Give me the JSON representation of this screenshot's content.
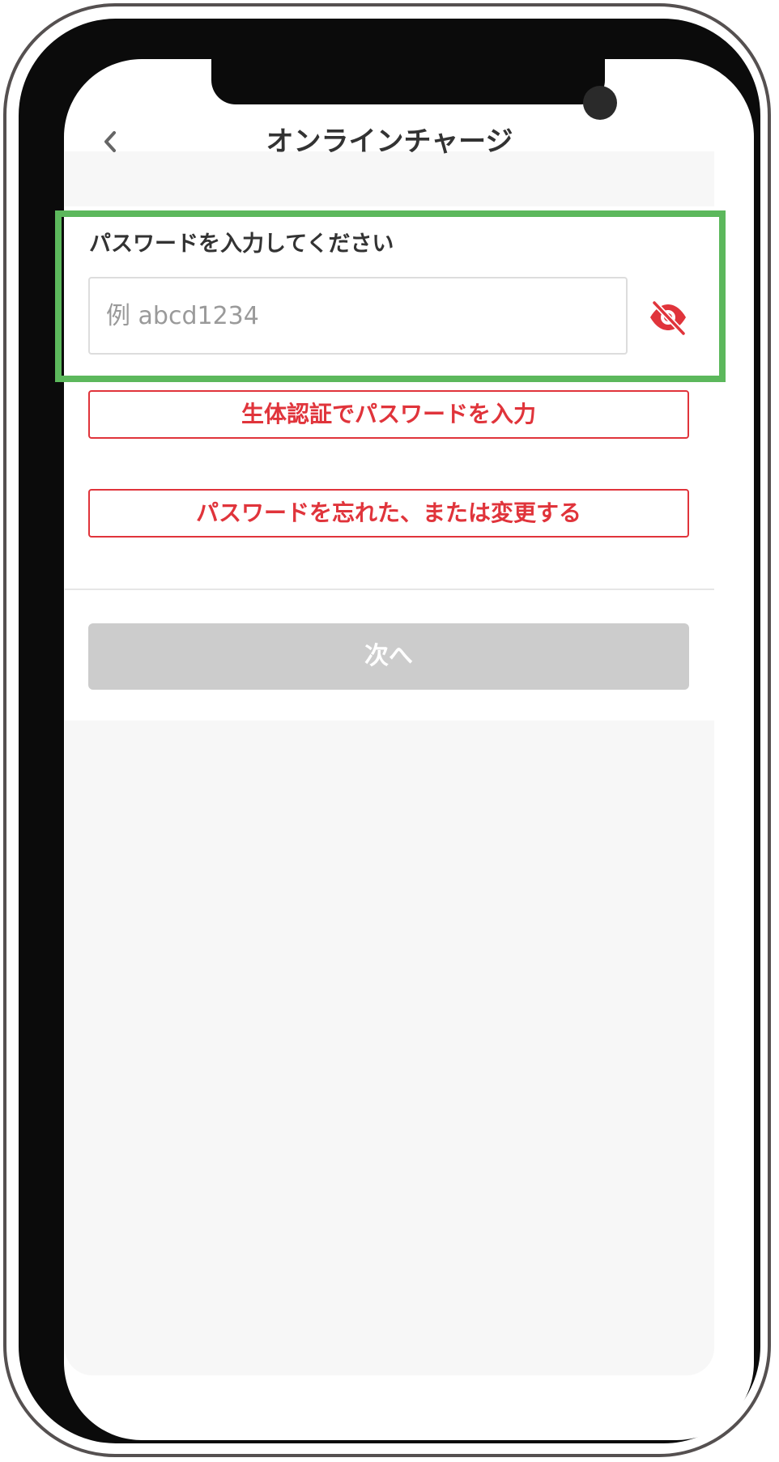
{
  "header": {
    "title": "オンラインチャージ",
    "back_icon": "chevron-left-icon"
  },
  "password": {
    "label": "パスワードを入力してください",
    "placeholder": "例 abcd1234",
    "value": "",
    "toggle_icon": "eye-slash-icon"
  },
  "actions": {
    "biometric_label": "生体認証でパスワードを入力",
    "forgot_label": "パスワードを忘れた、または変更する",
    "next_label": "次へ"
  },
  "colors": {
    "accent_red": "#e0343b",
    "highlight_green": "#5cb85c",
    "disabled_gray": "#cccccc"
  }
}
